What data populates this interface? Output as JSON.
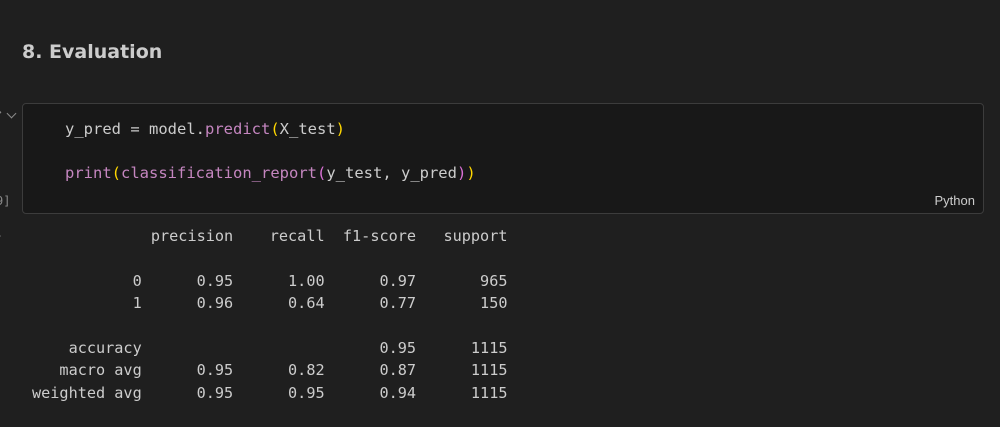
{
  "notebook": {
    "heading": "8. Evaluation",
    "cell": {
      "collapse_glyph": "⌄",
      "execution_count": "9]",
      "language": "Python",
      "code_lines": [
        {
          "indent": "",
          "tokens": [
            "y_pred",
            " = ",
            "model.",
            "predict",
            "(",
            "X_test",
            ")"
          ]
        },
        {
          "indent": "",
          "tokens": []
        },
        {
          "indent": "",
          "tokens": [
            "print",
            "(",
            "classification_report",
            "(",
            "y_test, y_pred",
            ")",
            ")"
          ]
        }
      ],
      "output_marker": "."
    },
    "report": {
      "header": [
        "precision",
        "recall",
        "f1-score",
        "support"
      ],
      "rows": [
        {
          "label": "0",
          "precision": "0.95",
          "recall": "1.00",
          "f1": "0.97",
          "support": "965"
        },
        {
          "label": "1",
          "precision": "0.96",
          "recall": "0.64",
          "f1": "0.77",
          "support": "150"
        },
        {
          "label": "accuracy",
          "precision": "",
          "recall": "",
          "f1": "0.95",
          "support": "1115"
        },
        {
          "label": "macro avg",
          "precision": "0.95",
          "recall": "0.82",
          "f1": "0.87",
          "support": "1115"
        },
        {
          "label": "weighted avg",
          "precision": "0.95",
          "recall": "0.95",
          "f1": "0.94",
          "support": "1115"
        }
      ]
    }
  }
}
